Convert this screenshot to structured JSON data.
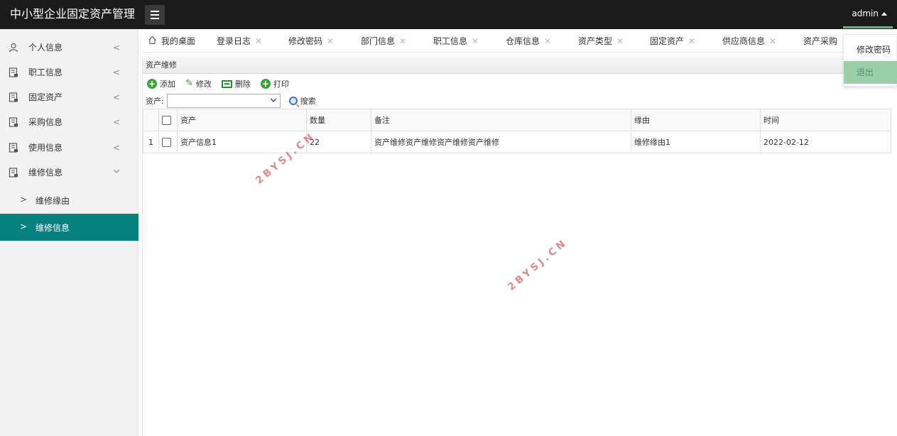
{
  "header": {
    "app_title": "中小型企业固定资产管理",
    "user_name": "admin"
  },
  "sidebar": {
    "items": [
      {
        "label": "个人信息",
        "icon": "user-icon"
      },
      {
        "label": "职工信息",
        "icon": "document-icon"
      },
      {
        "label": "固定资产",
        "icon": "document-icon"
      },
      {
        "label": "采购信息",
        "icon": "document-icon"
      },
      {
        "label": "使用信息",
        "icon": "document-icon"
      },
      {
        "label": "维修信息",
        "icon": "document-icon"
      }
    ],
    "sub_items": [
      {
        "label": "维修缘由",
        "active": false
      },
      {
        "label": "维修信息",
        "active": true
      }
    ],
    "active_color": "#078080"
  },
  "tabs": [
    {
      "label": "我的桌面",
      "icon": "home-icon"
    },
    {
      "label": "登录日志"
    },
    {
      "label": "修改密码"
    },
    {
      "label": "部门信息"
    },
    {
      "label": "职工信息"
    },
    {
      "label": "仓库信息"
    },
    {
      "label": "资产类型"
    },
    {
      "label": "固定资产"
    },
    {
      "label": "供应商信息"
    },
    {
      "label": "资产采购"
    }
  ],
  "dropdown": {
    "items": [
      "修改密码",
      "退出"
    ]
  },
  "panel": {
    "title": "资产维修",
    "toolbar": {
      "add": "添加",
      "edit": "修改",
      "delete": "删除",
      "print": "打印"
    },
    "search": {
      "label": "资产:",
      "button": "搜索"
    },
    "columns": [
      "资产",
      "数量",
      "备注",
      "缘由",
      "时间"
    ],
    "rows": [
      {
        "index": "1",
        "asset": "资产信息1",
        "qty": "22",
        "note": "资产维修资产维修资产维修资产维修",
        "reason": "维修缘由1",
        "time": "2022-02-12"
      }
    ]
  },
  "watermark": "2BYSJ.CN",
  "colors": {
    "header_bg": "#1b1b1b",
    "accent_green": "#5fb878",
    "dropdown_hover": "#9ccfa8"
  }
}
